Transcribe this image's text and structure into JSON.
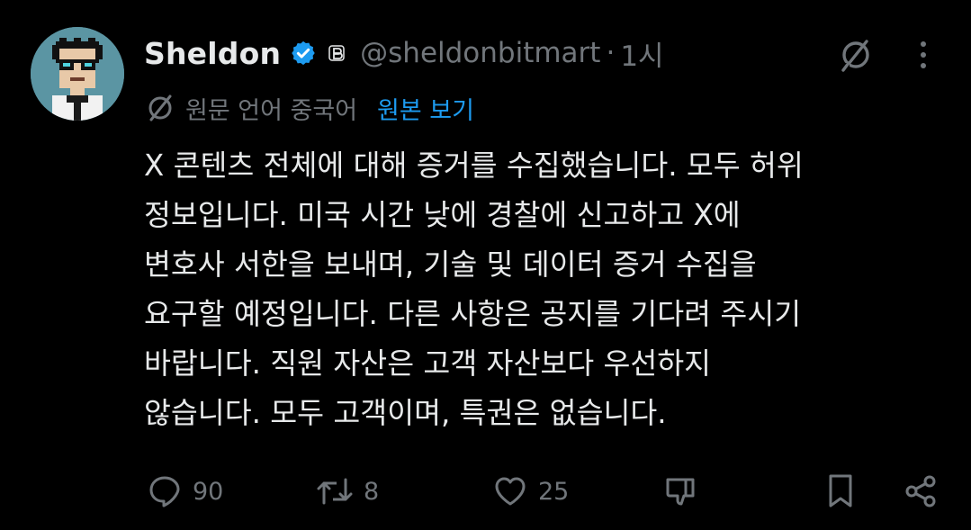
{
  "author": {
    "display_name": "Sheldon",
    "handle": "@sheldonbitmart",
    "separator": "·",
    "time_ago": "1시",
    "verified_color": "#1d9bf0",
    "avatar_icon": "pixel-art-avatar"
  },
  "translation": {
    "note": "원문 언어 중국어",
    "link_label": "원본 보기",
    "icon": "translate-icon"
  },
  "post": {
    "lines": [
      "X 콘텐츠 전체에 대해 증거를 수집했습니다. 모두 허위",
      "정보입니다. 미국 시간 낮에 경찰에 신고하고 X에",
      "변호사 서한을 보내며, 기술 및 데이터 증거 수집을",
      "요구할 예정입니다. 다른 사항은 공지를 기다려 주시기",
      "바랍니다. 직원 자산은 고객 자산보다 우선하지",
      "않습니다. 모두 고객이며, 특권은 없습니다."
    ]
  },
  "actions": {
    "replies": "90",
    "reposts": "8",
    "likes": "25"
  },
  "colors": {
    "background": "#000000",
    "text": "#e7e9ea",
    "muted": "#71767b",
    "accent": "#1d9bf0"
  }
}
